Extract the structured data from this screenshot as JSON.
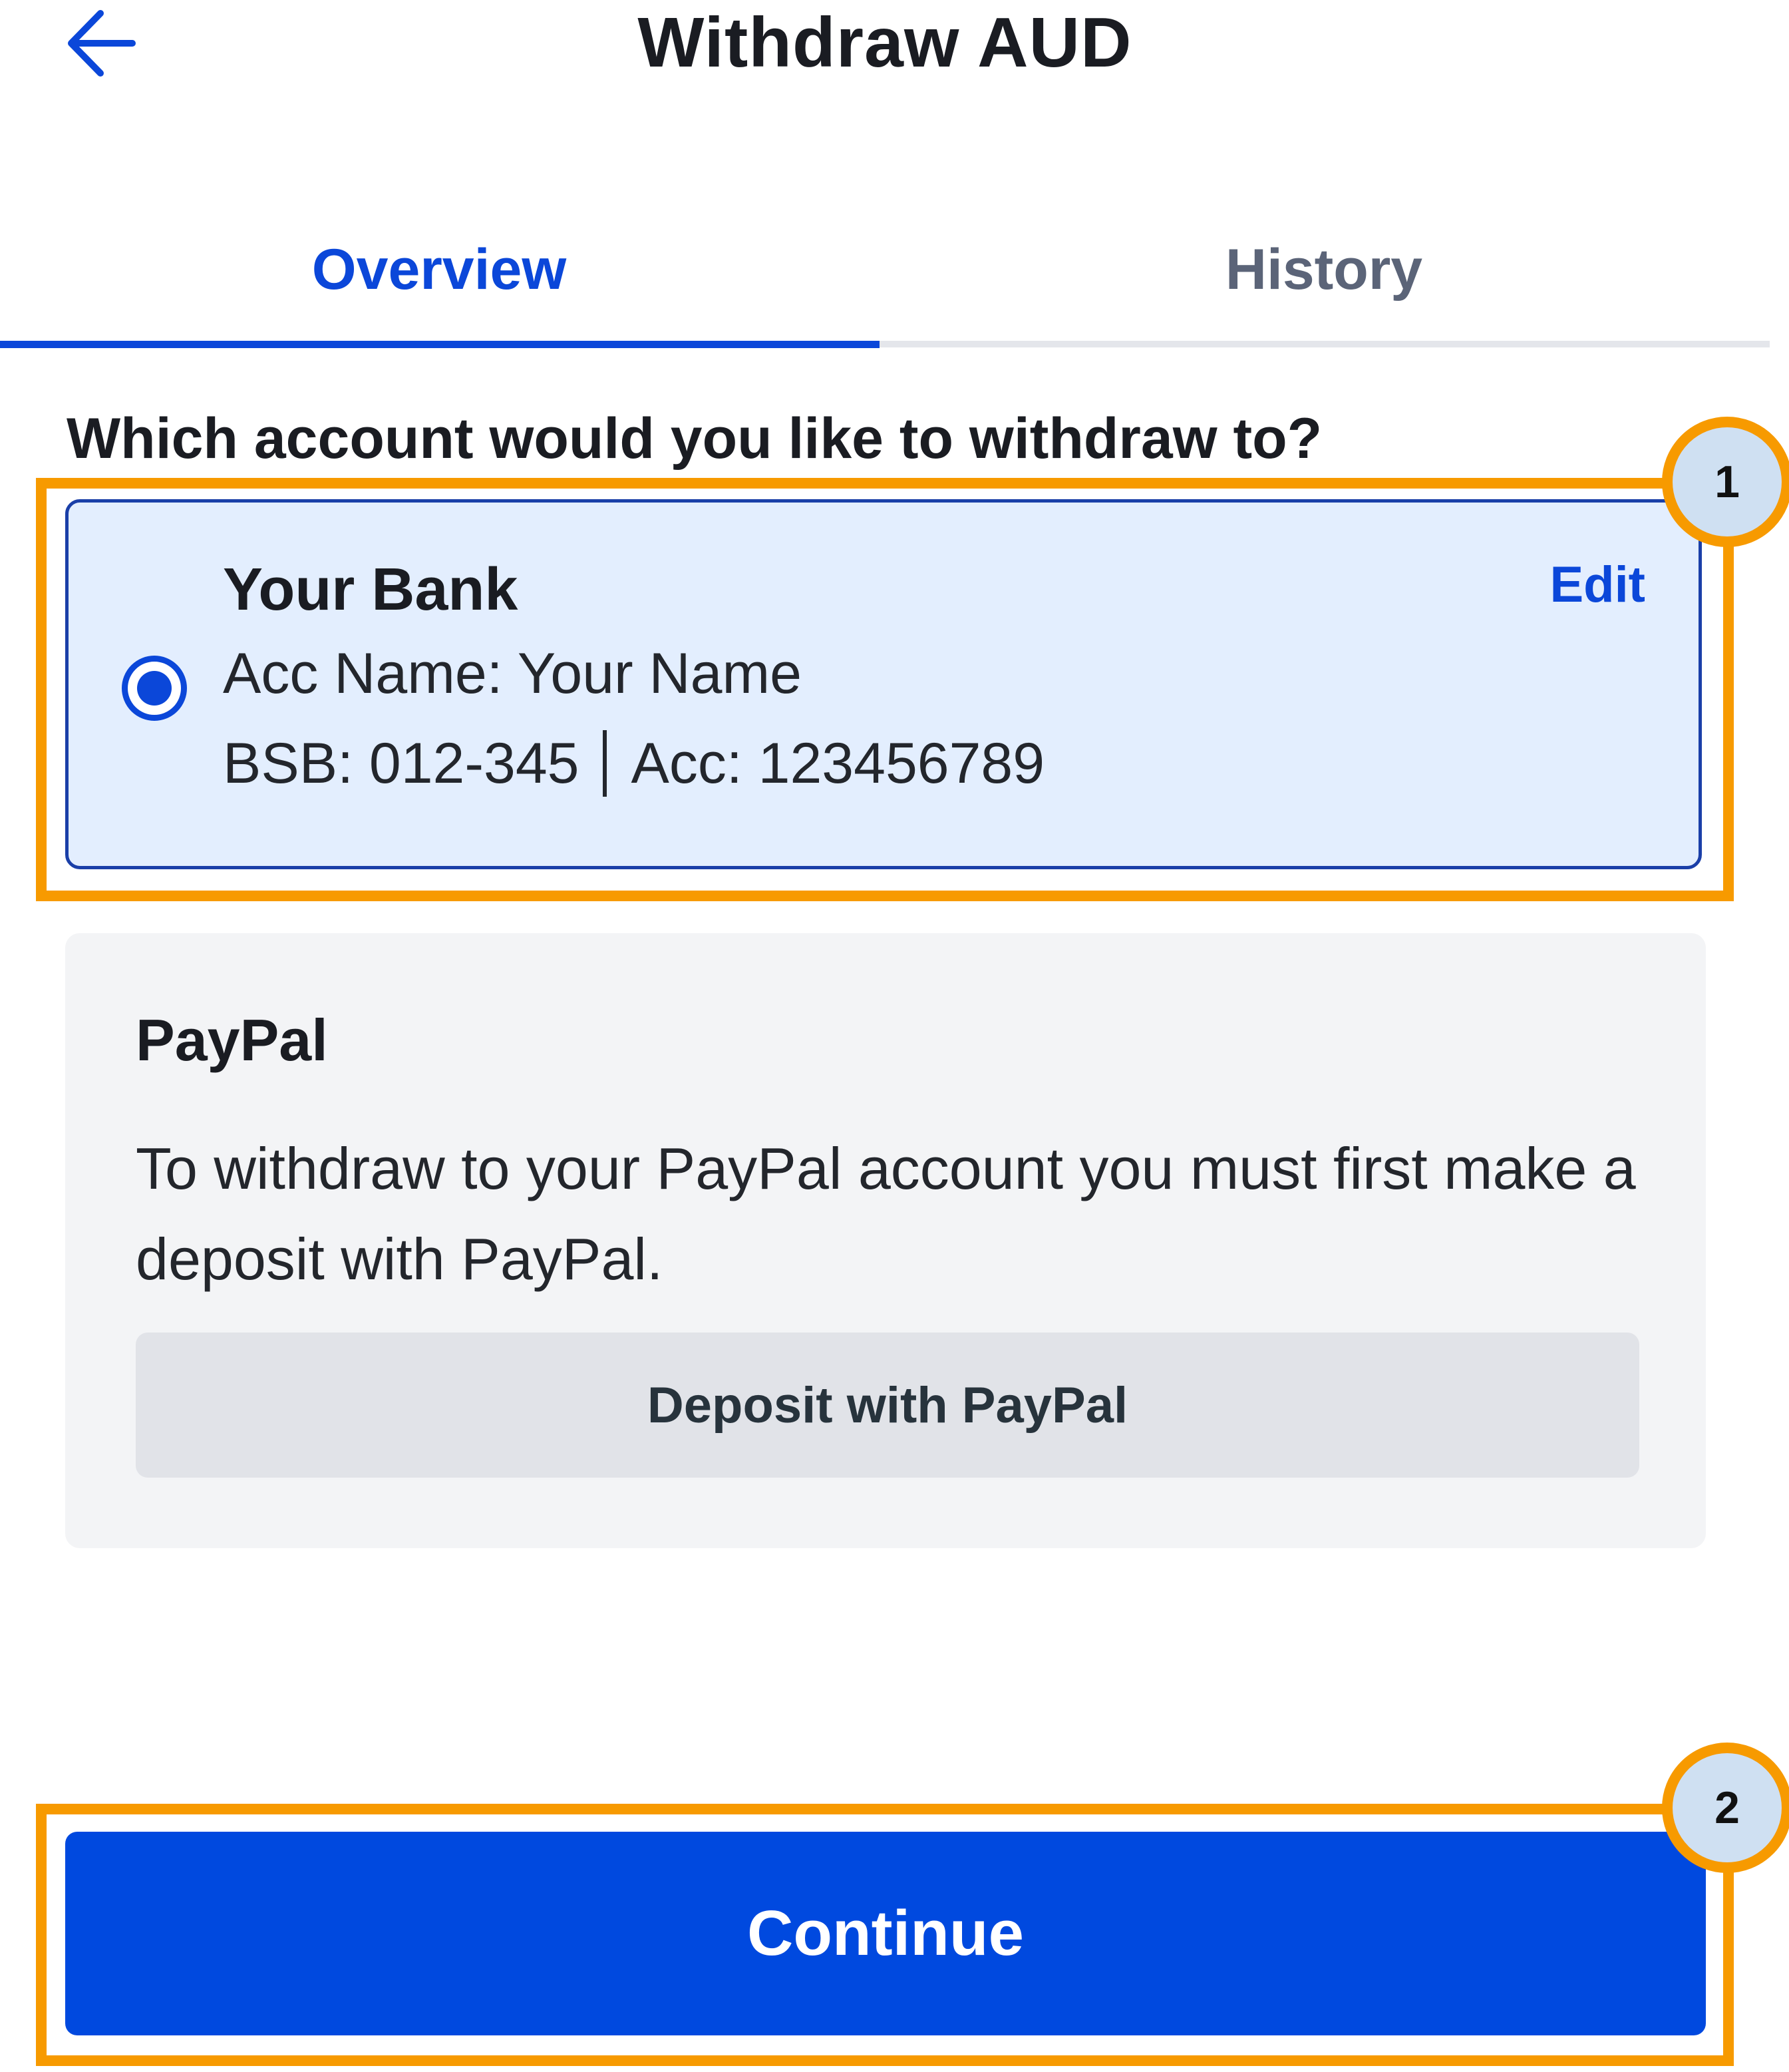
{
  "header": {
    "back_icon": "arrow-left-icon",
    "title": "Withdraw AUD"
  },
  "tabs": [
    {
      "label": "Overview",
      "active": true
    },
    {
      "label": "History",
      "active": false
    }
  ],
  "question": "Which account would you like to withdraw to?",
  "bank_account": {
    "selected": true,
    "name": "Your Bank",
    "acc_name_line": "Acc Name: Your Name",
    "bsb_text": "BSB: 012-345",
    "acc_text": "Acc: 123456789",
    "edit_label": "Edit"
  },
  "paypal": {
    "title": "PayPal",
    "description": "To withdraw to your PayPal account you must first make a deposit with PayPal.",
    "button_label": "Deposit with PayPal"
  },
  "continue_label": "Continue",
  "annotations": [
    {
      "label": "1"
    },
    {
      "label": "2"
    }
  ],
  "colors": {
    "accent": "#0b47d9",
    "primary_button": "#0049df",
    "annotation": "#f79a00",
    "annotation_badge_fill": "#cfe0f2",
    "selected_card_bg": "#e3eefe",
    "paypal_card_bg": "#f3f4f6"
  }
}
